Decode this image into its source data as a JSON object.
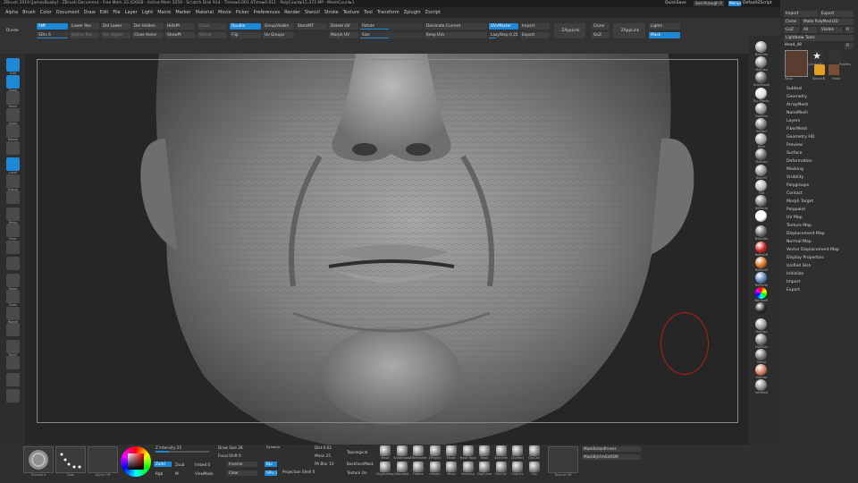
{
  "titlebar": "ZBrush 2019 [JamesBusby] · ZBrush Document · Free Mem 33.426GB · Active Mem 3259 · Scratch Disk 914 · Timer▸0.001 ATime▸0.011 · PolyCount▸15.373 MP · MeshCount▸1",
  "titlebar_right": {
    "quicksave": "QuickSave",
    "seethrough": "See-through 0",
    "menus": "Menus",
    "script": "DefaultZScript"
  },
  "menus": [
    "Alpha",
    "Brush",
    "Color",
    "Document",
    "Draw",
    "Edit",
    "File",
    "Layer",
    "Light",
    "Macro",
    "Marker",
    "Material",
    "Movie",
    "Picker",
    "Preferences",
    "Render",
    "Stencil",
    "Stroke",
    "Texture",
    "Tool",
    "Transform",
    "Zplugin",
    "Zscript"
  ],
  "toptools": {
    "divide": "Divide",
    "smt": "SMt",
    "sdiv": "SDiv 6",
    "lower_res": "Lower Res",
    "higher_res": "Higher Res",
    "del_lower": "Del Lower",
    "del_higher": "Del Higher",
    "del_hidden": "Del Hidden",
    "close_holes": "Close Holes",
    "hide_pt": "HidePt",
    "show_pt": "ShowPt",
    "grow": "Grow",
    "shrink": "Shrink",
    "double": "Double",
    "flip": "Flip",
    "group_visible": "GroupVisible",
    "uv_groups": "Uv Groups",
    "store_mt": "StoreMT",
    "morph_uv": "Morph UV",
    "delete_uv": "Delete UV",
    "rotate": "Rotate",
    "size": "Size",
    "decimate_current": "Decimate Current",
    "keep_uvs": "Keep UVs",
    "lazy_step": "LazyStep 0.25",
    "uvs_master": "UVsMaster",
    "import": "Import",
    "export": "Export",
    "append_link": "ZAppLink",
    "clone": "Clone",
    "goz": "GoZ",
    "append_link2": "ZAppLink",
    "lights": "Lights",
    "mask": "Mask"
  },
  "right_panel": {
    "import": "Import",
    "export": "Export",
    "clone": "Clone",
    "make_polymesh": "Make PolyMesh3D",
    "goz": "GoZ",
    "all": "All",
    "visible": "Visible",
    "r": "R",
    "lightbox": "Lightbox▸ Tools",
    "head": "Head_48",
    "r2": "R",
    "tools": [
      "Head",
      "SimpleB",
      "Head"
    ],
    "tool_labels": [
      "Cylinder3D",
      "PolyMes"
    ],
    "menu": [
      "Subtool",
      "Geometry",
      "ArrayMesh",
      "NanoMesh",
      "Layers",
      "FiberMesh",
      "Geometry HD",
      "Preview",
      "Surface",
      "Deformation",
      "Masking",
      "Visibility",
      "Polygroups",
      "Contact",
      "Morph Target",
      "Polypaint",
      "UV Map",
      "Texture Map",
      "Displacement Map",
      "Normal Map",
      "Vector Displacement Map",
      "Display Properties",
      "Unified Skin",
      "Initialize",
      "Import",
      "Export"
    ]
  },
  "left_shelf": [
    "Edit",
    "Draw",
    "Move",
    "Scale",
    "Rotate",
    "",
    "Local",
    "Frame",
    "",
    "Persp",
    "Floor",
    "",
    "",
    "Move",
    "Scale",
    "Rotate",
    "",
    "PolyF",
    "",
    "",
    ""
  ],
  "materials": [
    "BasicMa",
    "MatCap",
    "SkinShade",
    "Toy Plastic",
    "FastSha",
    "Reflect",
    "Blinn",
    "MatCap",
    "BasicM",
    "Flat",
    "Reflecte",
    "",
    "BasicMa",
    "ReflectR",
    "ReflectY",
    "Reflecte",
    "NormalR",
    "",
    "MatCap",
    "HDRGlo",
    "Metal",
    "Matcap",
    "JellyBea"
  ],
  "bottom": {
    "standard": "Standard",
    "dots": "Dots",
    "alpha_off": "Alpha Off",
    "texture_off": "Texture Off",
    "z_intensity": "Z Intensity 25",
    "zadd": "Zadd",
    "zsub": "Zsub",
    "rgb": "Rgb",
    "m": "M",
    "draw_size": "Draw Size 28",
    "focal_shift": "Focal Shift 0",
    "dynamic": "Dynamic",
    "imbed": "Imbed 0",
    "viewmask": "ViewMask",
    "inverse": "Inverse",
    "clear": "Clear",
    "bpr": "Bpr",
    "spix": "SPix 3",
    "dist": "Dist 0.02",
    "mean": "Mean 25",
    "pa_blur": "PA Blur 10",
    "projection_shell": "Projection Shell 0",
    "topological": "Topological",
    "backface_mask": "BackfaceMask",
    "texture_on": "Texture On",
    "mask_smoothness": "MaskSmoothness",
    "mask_uv": "MaskByUVsEditSM",
    "brushes_row1": [
      "Move",
      "Snakehook",
      "ZRemesher",
      "ZProject",
      "Morph",
      "Move Topo",
      "Mask",
      "SelectRe",
      "ClipRect",
      "ClipCirc"
    ],
    "brushes_row2": [
      "ClayBuildup",
      "Standard",
      "Flatten",
      "hPolish",
      "Move",
      "SelectLa",
      "ClipCurve",
      "ClipCirc",
      "ClipCirc",
      "Clip"
    ]
  }
}
